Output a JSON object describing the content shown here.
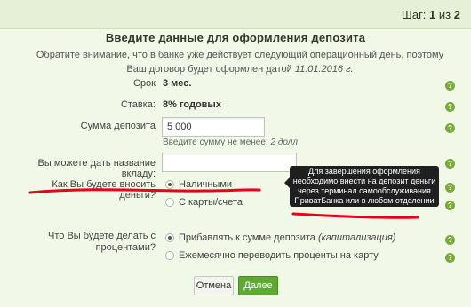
{
  "header": {
    "step_prefix": "Шаг:",
    "step_current": "1",
    "step_sep": "из",
    "step_total": "2"
  },
  "title": "Введите данные для оформления депозита",
  "notice": "Обратите внимание, что в банке уже действует следующий операционный день, поэтому Ваш договор будет оформлен датой",
  "notice_date": "11.01.2016 г.",
  "form": {
    "term_label": "Срок",
    "term_value": "3 мес.",
    "rate_label": "Ставка:",
    "rate_value": "8% годовых",
    "amount_label": "Сумма депозита",
    "amount_value": "5 000",
    "amount_hint": "Введите сумму не менее:",
    "amount_hint_min": "2 долл",
    "name_label": "Вы можете дать название вкладу:",
    "name_value": "",
    "deposit_method_label": "Как Вы будете вносить деньги",
    "deposit_method_q": "?",
    "deposit_options": [
      "Наличными",
      "С карты/счета"
    ],
    "interest_label_line1": "Что Вы будете делать с",
    "interest_label_line2": "процентами?",
    "interest_options": [
      "Прибавлять к сумме депозита",
      "Ежемесячно переводить проценты на карту"
    ],
    "interest_option1_note": "(капитализация)"
  },
  "tooltip": {
    "line1": "Для завершения оформления",
    "line2": "необходимо внести на депозит деньги",
    "line3": "через терминал самообслуживания",
    "line4": "ПриватБанка или в любом отделении"
  },
  "buttons": {
    "cancel": "Отмена",
    "next": "Далее"
  },
  "help_glyph": "?",
  "colors": {
    "accent": "#5fa832",
    "annotation": "#e8001a",
    "tooltip_bg": "#1f1f1f"
  }
}
